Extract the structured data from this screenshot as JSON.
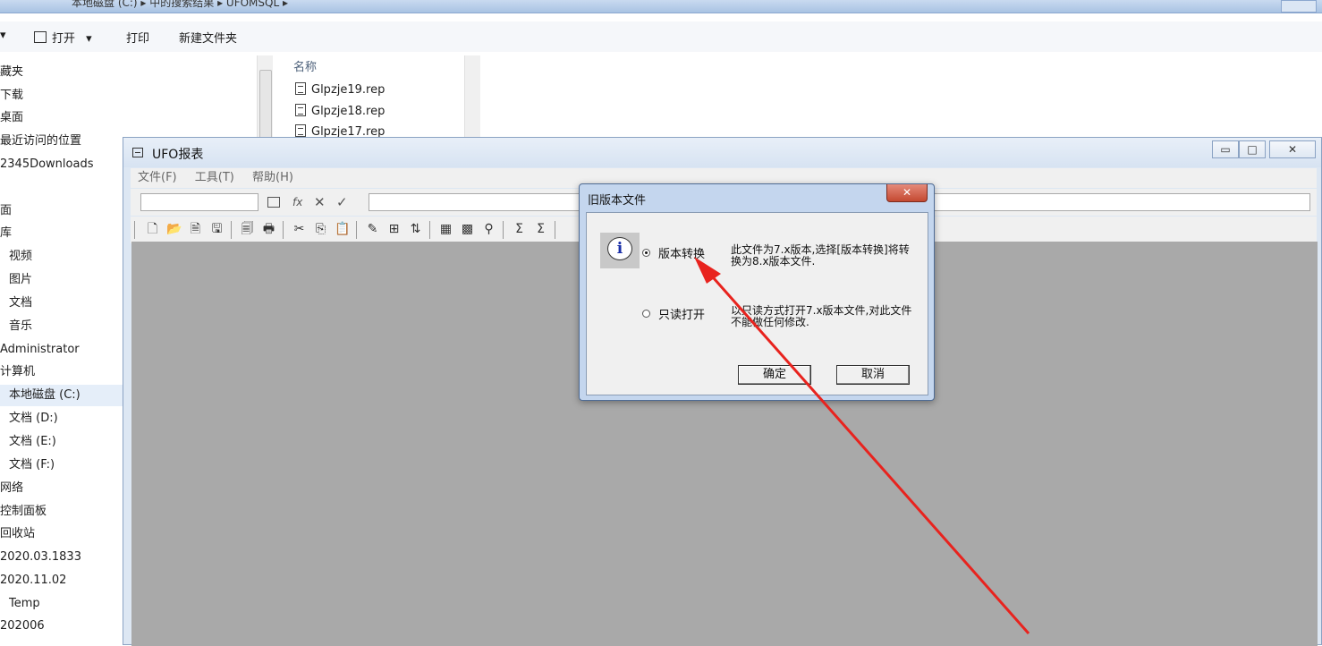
{
  "explorer": {
    "breadcrumb": "本地磁盘 (C:)  ▸  中的搜索结果  ▸  UFOMSQL  ▸",
    "toolbar": {
      "organize_arrow": "▾",
      "open_label": "打开",
      "open_arrow": "▾",
      "print_label": "打印",
      "new_folder_label": "新建文件夹"
    },
    "nav_items": [
      {
        "label": "藏夹"
      },
      {
        "label": "下载"
      },
      {
        "label": "桌面"
      },
      {
        "label": "最近访问的位置"
      },
      {
        "label": "2345Downloads"
      },
      {
        "label": ""
      },
      {
        "label": "面"
      },
      {
        "label": "库"
      },
      {
        "label": "视频"
      },
      {
        "label": "图片"
      },
      {
        "label": "文档"
      },
      {
        "label": "音乐"
      },
      {
        "label": "Administrator"
      },
      {
        "label": "计算机"
      },
      {
        "label": "本地磁盘 (C:)"
      },
      {
        "label": "文档 (D:)"
      },
      {
        "label": "文档 (E:)"
      },
      {
        "label": "文档 (F:)"
      },
      {
        "label": "网络"
      },
      {
        "label": "控制面板"
      },
      {
        "label": "回收站"
      },
      {
        "label": "2020.03.1833"
      },
      {
        "label": "2020.11.02"
      },
      {
        "label": "Temp"
      },
      {
        "label": "202006"
      }
    ],
    "selected_nav": "本地磁盘 (C:)",
    "files": {
      "column_name": "名称",
      "items": [
        {
          "name": "Glpzje19.rep"
        },
        {
          "name": "Glpzje18.rep"
        },
        {
          "name": "Glpzje17.rep"
        }
      ]
    }
  },
  "ufo": {
    "title": "UFO报表",
    "window_buttons": {
      "minimize": "▭",
      "maximize": "□",
      "close": "✕"
    },
    "menu": [
      {
        "label": "文件(F)"
      },
      {
        "label": "工具(T)"
      },
      {
        "label": "帮助(H)"
      }
    ],
    "edit_bar": {
      "fx": "fx",
      "cancel": "✕",
      "accept": "✓"
    }
  },
  "dialog": {
    "title": "旧版本文件",
    "close_glyph": "✕",
    "options": [
      {
        "label": "版本转换",
        "selected": true,
        "description": "此文件为7.x版本,选择[版本转换]将转换为8.x版本文件."
      },
      {
        "label": "只读打开",
        "selected": false,
        "description": "以只读方式打开7.x版本文件,对此文件不能做任何修改."
      }
    ],
    "ok_label": "确定",
    "cancel_label": "取消"
  },
  "colors": {
    "annotation_arrow": "#e8231e",
    "client_area": "#a9a9a9",
    "dialog_frame": "#c4d6ee"
  }
}
